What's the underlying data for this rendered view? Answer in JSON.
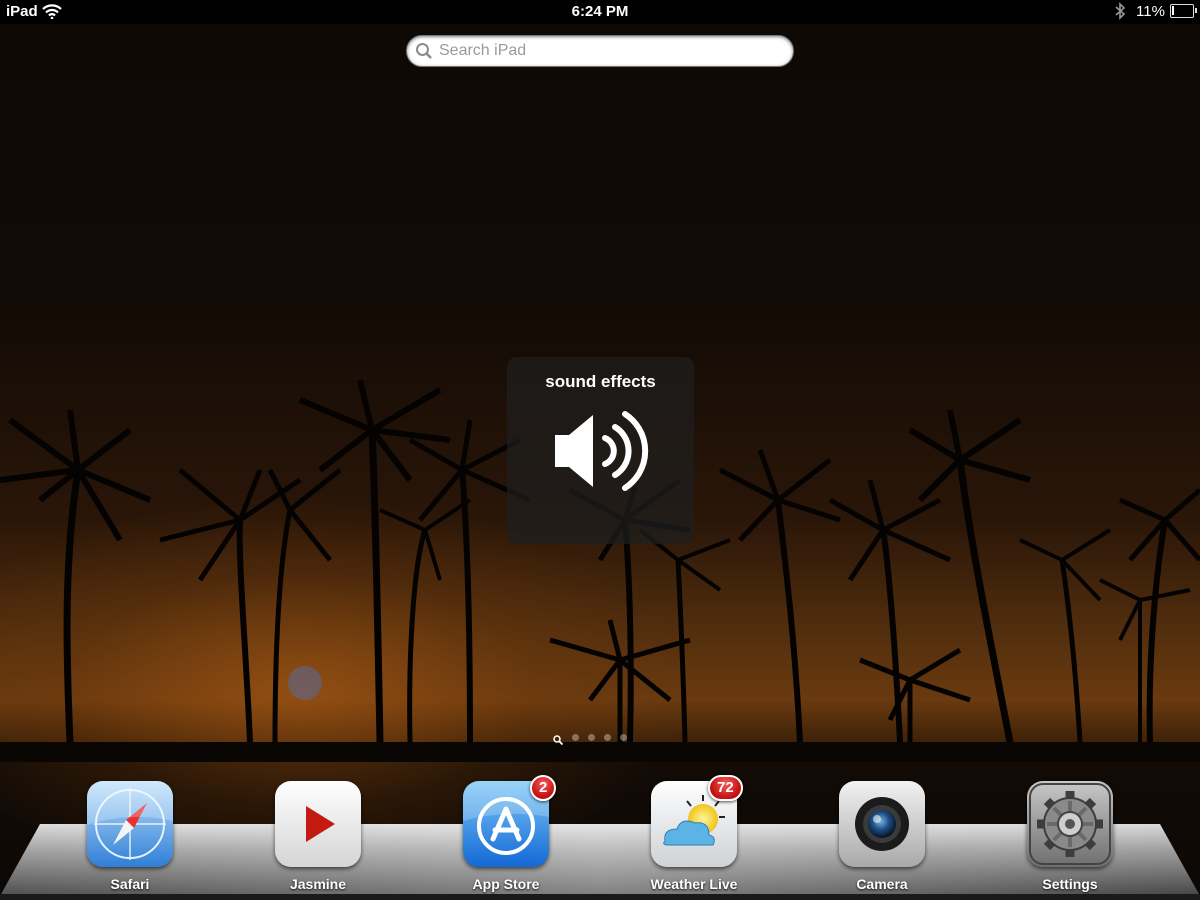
{
  "status_bar": {
    "carrier": "iPad",
    "time": "6:24 PM",
    "battery_percent": "11%",
    "battery_level": 0.11,
    "icons": [
      "wifi-icon",
      "bluetooth-icon",
      "battery-icon"
    ]
  },
  "search": {
    "placeholder": "Search iPad"
  },
  "hud": {
    "title": "sound effects",
    "icon": "speaker-icon"
  },
  "page_indicator": {
    "pages": 4,
    "current": "search"
  },
  "dock": {
    "apps": [
      {
        "label": "Safari",
        "icon": "safari-icon",
        "badge": ""
      },
      {
        "label": "Jasmine",
        "icon": "jasmine-icon",
        "badge": ""
      },
      {
        "label": "App Store",
        "icon": "app-store-icon",
        "badge": "2"
      },
      {
        "label": "Weather Live",
        "icon": "weather-live-icon",
        "badge": "72"
      },
      {
        "label": "Camera",
        "icon": "camera-icon",
        "badge": ""
      },
      {
        "label": "Settings",
        "icon": "settings-icon",
        "badge": ""
      }
    ]
  }
}
